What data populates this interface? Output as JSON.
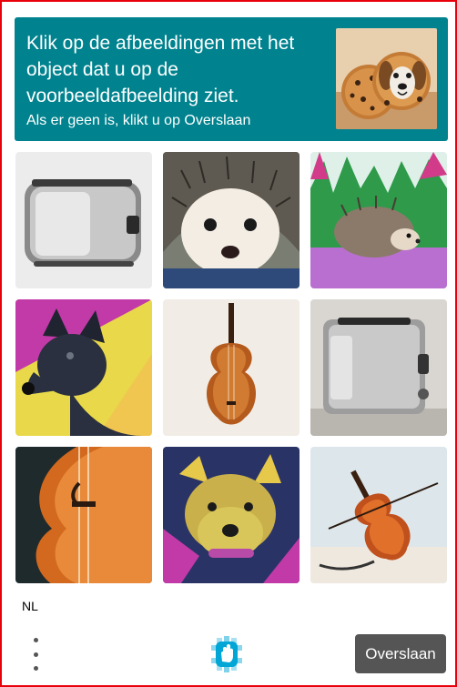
{
  "prompt": {
    "title": "Klik op de afbeeldingen met het object dat u op de voorbeeldafbeelding ziet.",
    "subtitle": "Als er geen is, klikt u op Overslaan",
    "background": "#00838f",
    "example_image": "cookie-dog-example"
  },
  "grid": {
    "tiles": [
      {
        "subject": "toaster-image"
      },
      {
        "subject": "hedgehog-image"
      },
      {
        "subject": "hedgehog-watercolor-image"
      },
      {
        "subject": "black-dog-image"
      },
      {
        "subject": "violin-image"
      },
      {
        "subject": "toaster-image"
      },
      {
        "subject": "violin-closeup-image"
      },
      {
        "subject": "terrier-dog-image"
      },
      {
        "subject": "violin-painting-image"
      }
    ]
  },
  "footer": {
    "language": "NL",
    "skip_label": "Overslaan",
    "menu_icon": "more-vertical-icon",
    "logo_icon": "hcaptcha-logo-icon"
  },
  "colors": {
    "border": "#e8000b",
    "skip_button": "#555555",
    "logo": "#00a6d6"
  }
}
